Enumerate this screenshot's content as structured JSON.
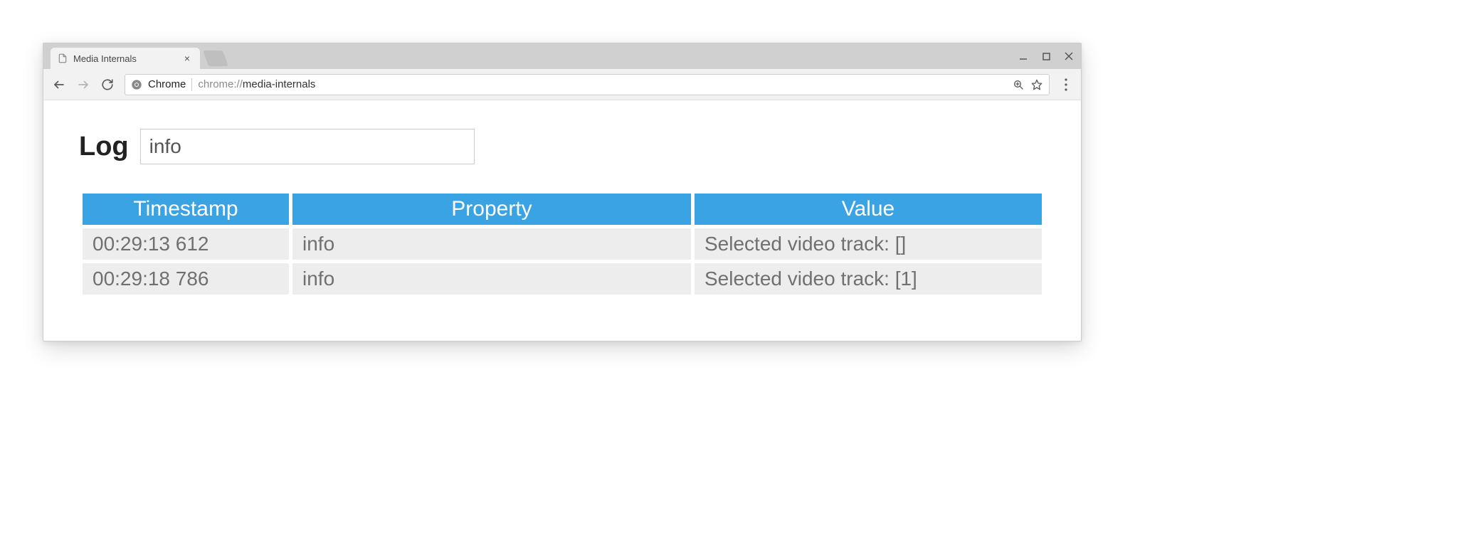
{
  "browser": {
    "tab_title": "Media Internals",
    "scheme_label": "Chrome",
    "url_prefix": "chrome://",
    "url_path": "media-internals"
  },
  "page": {
    "log_heading": "Log",
    "filter_value": "info"
  },
  "table": {
    "headers": {
      "timestamp": "Timestamp",
      "property": "Property",
      "value": "Value"
    },
    "rows": [
      {
        "timestamp": "00:29:13 612",
        "property": "info",
        "value": "Selected video track: []"
      },
      {
        "timestamp": "00:29:18 786",
        "property": "info",
        "value": "Selected video track: [1]"
      }
    ]
  }
}
